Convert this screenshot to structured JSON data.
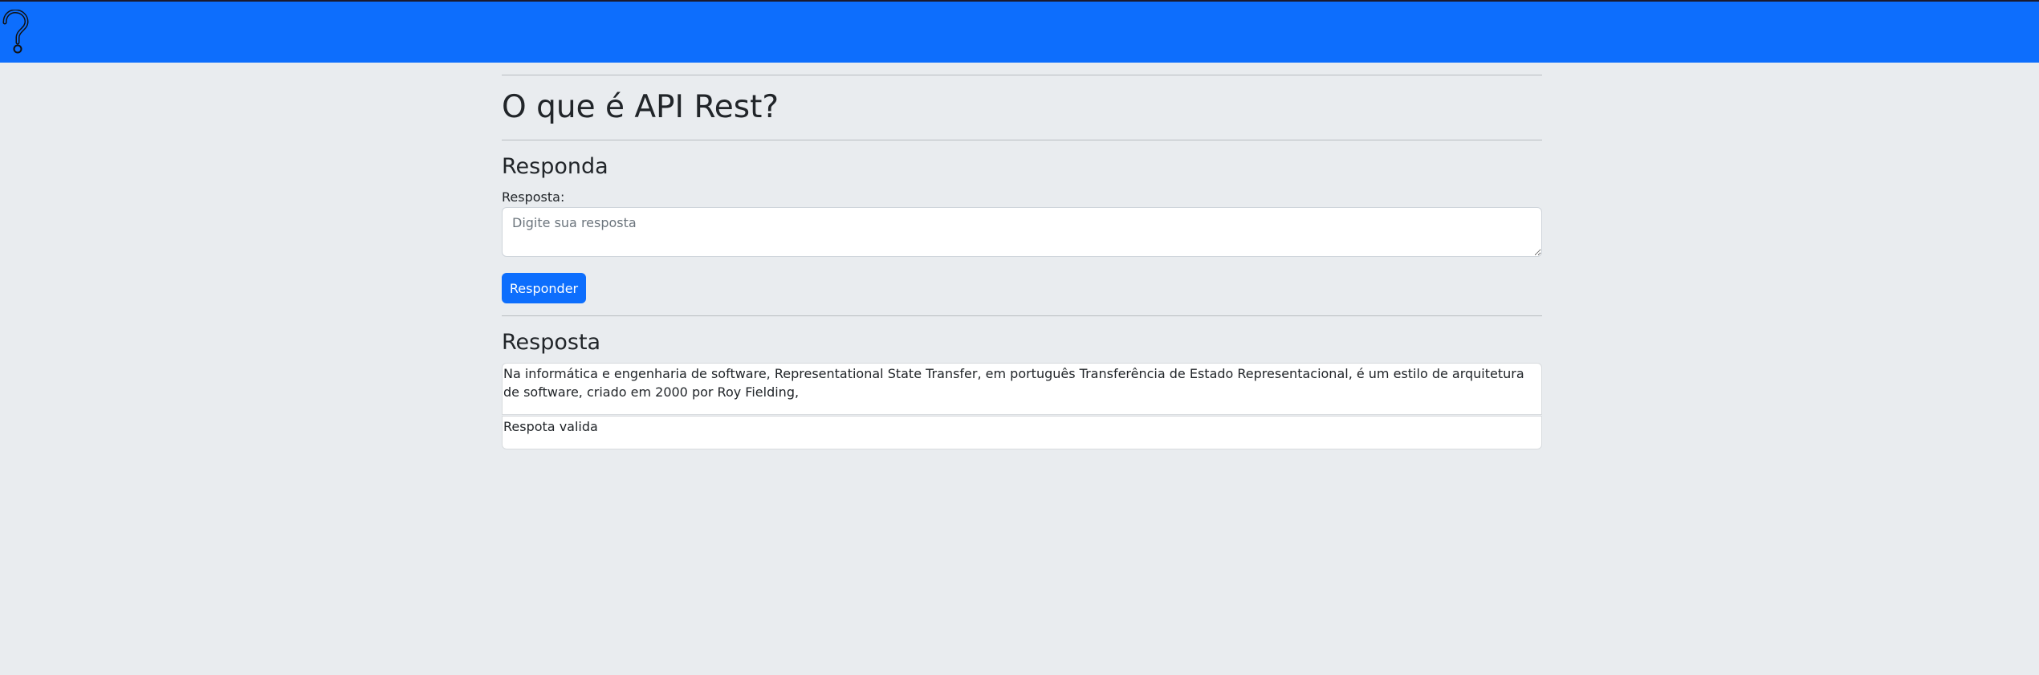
{
  "navbar": {
    "icon": "question-mark-icon",
    "background_color": "#0d6efd"
  },
  "question": {
    "title": "O que é API Rest?"
  },
  "answer_form": {
    "heading": "Responda",
    "label": "Resposta:",
    "value": "",
    "placeholder": "Digite sua resposta",
    "submit_label": "Responder"
  },
  "answers": {
    "heading": "Resposta",
    "items": [
      {
        "text": "Na informática e engenharia de software, Representational State Transfer, em português Transferência de Estado Representacional, é um estilo de arquitetura de software, criado em 2000 por Roy Fielding,"
      },
      {
        "text": "Respota valida"
      }
    ]
  },
  "colors": {
    "primary": "#0d6efd",
    "page_background": "#e9ecef"
  }
}
